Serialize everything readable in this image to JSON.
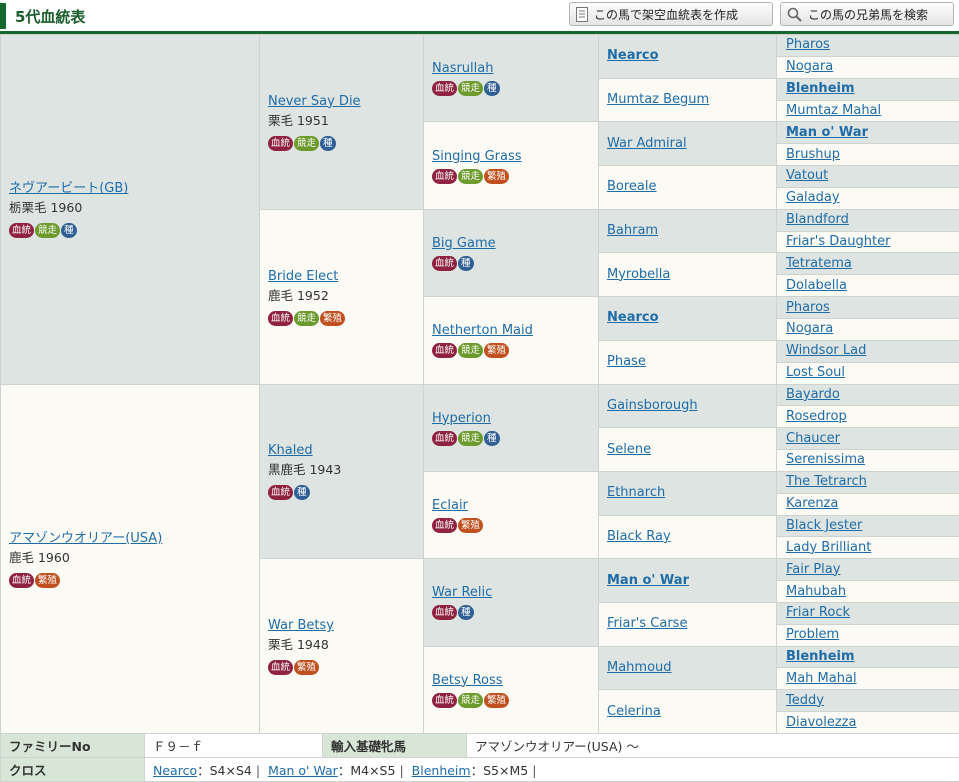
{
  "header": {
    "title": "5代血統表",
    "create_button": "この馬で架空血統表を作成",
    "sibling_button": "この馬の兄弟馬を検索"
  },
  "badges": {
    "bloodline": "血統",
    "race": "競走",
    "sire": "種",
    "broodmare": "繁殖"
  },
  "colors": {
    "accent": "#15692f",
    "link": "#1f6ca7",
    "male_bg": "#dde4e2",
    "female_bg": "#fcfaf4"
  },
  "pedigree": {
    "g1": [
      {
        "name": "ネヴアービート(GB)",
        "info": "栃栗毛 1960"
      },
      {
        "name": "アマゾンウオリアー(USA)",
        "info": "鹿毛 1960"
      }
    ],
    "g2": [
      {
        "name": "Never Say Die",
        "info": "栗毛 1951"
      },
      {
        "name": "Bride Elect",
        "info": "鹿毛 1952"
      },
      {
        "name": "Khaled",
        "info": "黒鹿毛 1943"
      },
      {
        "name": "War Betsy",
        "info": "栗毛 1948"
      }
    ],
    "g3": [
      {
        "name": "Nasrullah"
      },
      {
        "name": "Singing Grass"
      },
      {
        "name": "Big Game"
      },
      {
        "name": "Netherton Maid"
      },
      {
        "name": "Hyperion"
      },
      {
        "name": "Eclair"
      },
      {
        "name": "War Relic"
      },
      {
        "name": "Betsy Ross"
      }
    ],
    "g4": [
      {
        "name": "Nearco"
      },
      {
        "name": "Mumtaz Begum"
      },
      {
        "name": "War Admiral"
      },
      {
        "name": "Boreale"
      },
      {
        "name": "Bahram"
      },
      {
        "name": "Myrobella"
      },
      {
        "name": "Nearco"
      },
      {
        "name": "Phase"
      },
      {
        "name": "Gainsborough"
      },
      {
        "name": "Selene"
      },
      {
        "name": "Ethnarch"
      },
      {
        "name": "Black Ray"
      },
      {
        "name": "Man o' War"
      },
      {
        "name": "Friar's Carse"
      },
      {
        "name": "Mahmoud"
      },
      {
        "name": "Celerina"
      }
    ],
    "g5": [
      {
        "name": "Pharos"
      },
      {
        "name": "Nogara"
      },
      {
        "name": "Blenheim"
      },
      {
        "name": "Mumtaz Mahal"
      },
      {
        "name": "Man o' War"
      },
      {
        "name": "Brushup"
      },
      {
        "name": "Vatout"
      },
      {
        "name": "Galaday"
      },
      {
        "name": "Blandford"
      },
      {
        "name": "Friar's Daughter"
      },
      {
        "name": "Tetratema"
      },
      {
        "name": "Dolabella"
      },
      {
        "name": "Pharos"
      },
      {
        "name": "Nogara"
      },
      {
        "name": "Windsor Lad"
      },
      {
        "name": "Lost Soul"
      },
      {
        "name": "Bayardo"
      },
      {
        "name": "Rosedrop"
      },
      {
        "name": "Chaucer"
      },
      {
        "name": "Serenissima"
      },
      {
        "name": "The Tetrarch"
      },
      {
        "name": "Karenza"
      },
      {
        "name": "Black Jester"
      },
      {
        "name": "Lady Brilliant"
      },
      {
        "name": "Fair Play"
      },
      {
        "name": "Mahubah"
      },
      {
        "name": "Friar Rock"
      },
      {
        "name": "Problem"
      },
      {
        "name": "Blenheim"
      },
      {
        "name": "Mah Mahal"
      },
      {
        "name": "Teddy"
      },
      {
        "name": "Diavolezza"
      }
    ]
  },
  "footer": {
    "family_label": "ファミリーNo",
    "family_value": "Ｆ９－ｆ",
    "import_label": "輸入基礎牝馬",
    "import_value": "アマゾンウオリアー(USA) ～",
    "cross_label": "クロス",
    "crosses": [
      {
        "horse": "Nearco",
        "value": "S4×S4"
      },
      {
        "horse": "Man o' War",
        "value": "M4×S5"
      },
      {
        "horse": "Blenheim",
        "value": "S5×M5"
      }
    ]
  }
}
